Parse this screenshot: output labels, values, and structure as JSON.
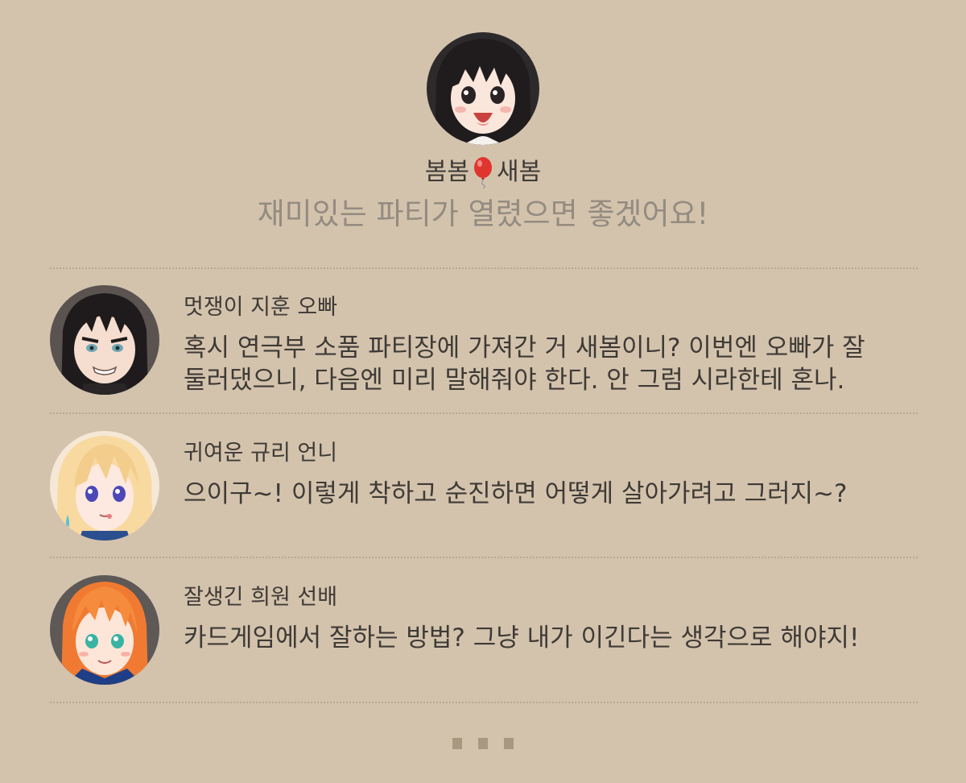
{
  "profile": {
    "name_first": "봄봄",
    "name_icon": "balloon-icon",
    "name_second": "새봄",
    "status": "재미있는 파티가 열렸으면 좋겠어요!"
  },
  "comments": [
    {
      "author": "멋쟁이 지훈 오빠",
      "text": "혹시 연극부 소품 파티장에 가져간 거 새봄이니? 이번엔 오빠가 잘\n둘러댔으니, 다음엔 미리 말해줘야 한다. 안 그럼 시라한테 혼나."
    },
    {
      "author": "귀여운 규리 언니",
      "text": "으이구~! 이렇게 착하고 순진하면 어떻게 살아가려고 그러지~?"
    },
    {
      "author": "잘생긴 희원 선배",
      "text": "카드게임에서 잘하는 방법? 그냥 내가 이긴다는 생각으로 해야지!"
    }
  ],
  "pagination": {
    "total": 3
  },
  "colors": {
    "background": "#d3c3ad",
    "text": "#3f3a35",
    "status_text": "#948b80",
    "divider": "#b8a991",
    "page_dot": "#a8987f"
  }
}
